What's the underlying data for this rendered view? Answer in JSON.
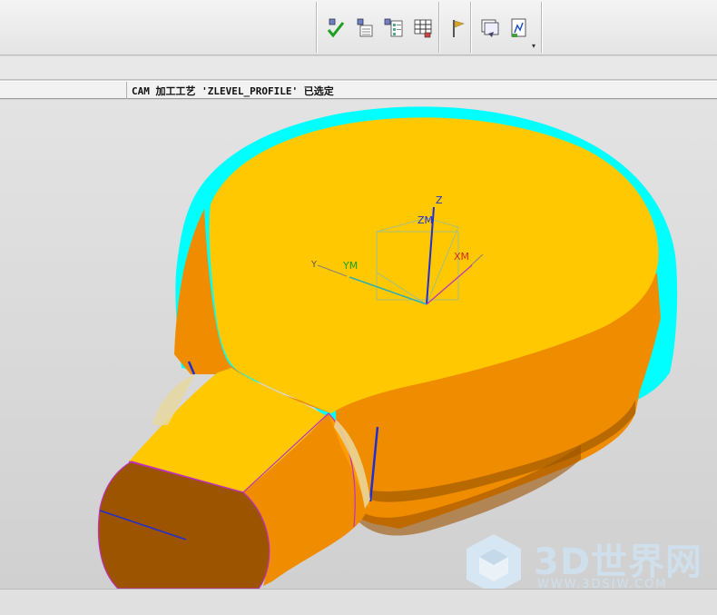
{
  "toolbar": {
    "ghost_label": "",
    "overflow_indicator": "▾",
    "icons": [
      "verify-toolpath-icon",
      "operation-list-icon",
      "tool-list-icon",
      "workpiece-table-icon",
      "post-process-flag-icon",
      "shop-doc-icon",
      "output-clsf-icon"
    ]
  },
  "status": {
    "message": "CAM 加工工艺 'ZLEVEL_PROFILE' 已选定"
  },
  "viewport": {
    "axes": {
      "z": "Z",
      "zm": "ZM",
      "ym": "YM",
      "xm": "XM",
      "y": "Y"
    },
    "colors": {
      "part_top": "#ffc800",
      "part_side": "#f08c00",
      "handle_end": "#9c5400",
      "blank": "#00ffff",
      "edge": "#c030c0",
      "toolpath": "#2030d0"
    }
  },
  "watermark": {
    "brand": "3D世界网",
    "url": "WWW.3DSJW.COM"
  }
}
